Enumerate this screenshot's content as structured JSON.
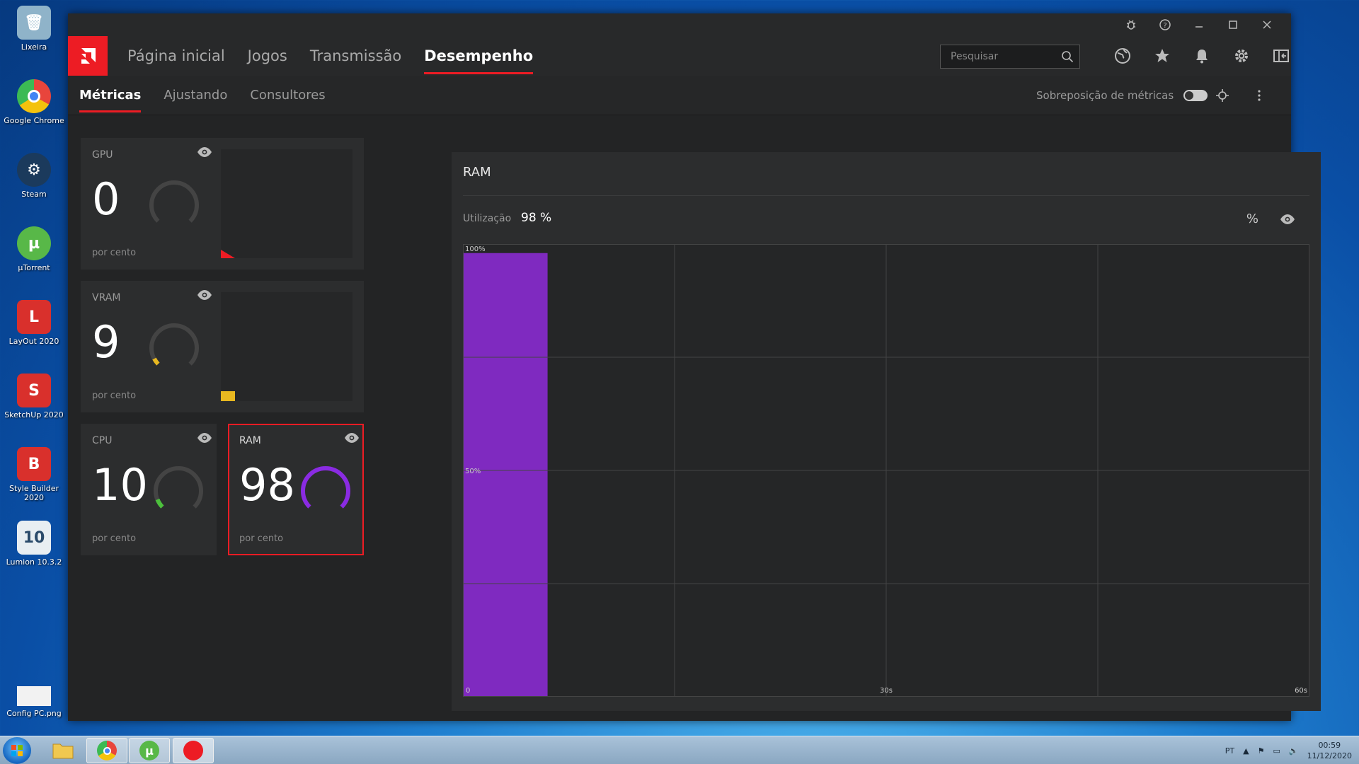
{
  "desktop": {
    "icons": [
      {
        "label": "Lixeira",
        "icon": "recycle-bin-icon",
        "color": "#8fb3c9"
      },
      {
        "label": "Google Chrome",
        "icon": "chrome-icon",
        "color": "#e8453c"
      },
      {
        "label": "Steam",
        "icon": "steam-icon",
        "color": "#1b3a5c"
      },
      {
        "label": "µTorrent",
        "icon": "utorrent-icon",
        "color": "#58b848"
      },
      {
        "label": "LayOut 2020",
        "icon": "layout-icon",
        "color": "#d9302c"
      },
      {
        "label": "SketchUp 2020",
        "icon": "sketchup-icon",
        "color": "#d9302c"
      },
      {
        "label": "Style Builder 2020",
        "icon": "style-builder-icon",
        "color": "#d9302c"
      },
      {
        "label": "Lumion 10.3.2",
        "icon": "lumion-icon",
        "color": "#e8eef2"
      },
      {
        "label": "Config PC.png",
        "icon": "image-file-icon",
        "color": "#f2f2f2"
      }
    ]
  },
  "nav": {
    "tabs": [
      "Página inicial",
      "Jogos",
      "Transmissão",
      "Desempenho"
    ],
    "active": "Desempenho",
    "search_placeholder": "Pesquisar"
  },
  "subnav": {
    "tabs": [
      "Métricas",
      "Ajustando",
      "Consultores"
    ],
    "active": "Métricas",
    "overlay_label": "Sobreposição de métricas",
    "overlay_enabled": false
  },
  "metrics": [
    {
      "label": "GPU",
      "value": "0",
      "unit": "por cento",
      "percent": 0,
      "color": "#ed1c24"
    },
    {
      "label": "VRAM",
      "value": "9",
      "unit": "por cento",
      "percent": 9,
      "color": "#e8b820"
    },
    {
      "label": "CPU",
      "value": "10",
      "unit": "por cento",
      "percent": 10,
      "color": "#4cc03c"
    },
    {
      "label": "RAM",
      "value": "98",
      "unit": "por cento",
      "percent": 98,
      "color": "#8a2be2"
    }
  ],
  "panel": {
    "title": "RAM",
    "util_label": "Utilização",
    "util_value": "98 %",
    "unit_button": "%"
  },
  "chart_data": {
    "type": "area",
    "title": "RAM",
    "x_range": [
      0,
      60
    ],
    "y_range": [
      0,
      100
    ],
    "y_labels": [
      "100%",
      "50%"
    ],
    "x_labels": [
      "0",
      "30s",
      "60s"
    ],
    "grid": true,
    "series": [
      {
        "color": "#7f2ac0",
        "x": [
          0,
          6
        ],
        "y": [
          98,
          98
        ]
      }
    ]
  },
  "taskbar": {
    "language": "PT",
    "time": "00:59",
    "date": "11/12/2020"
  }
}
